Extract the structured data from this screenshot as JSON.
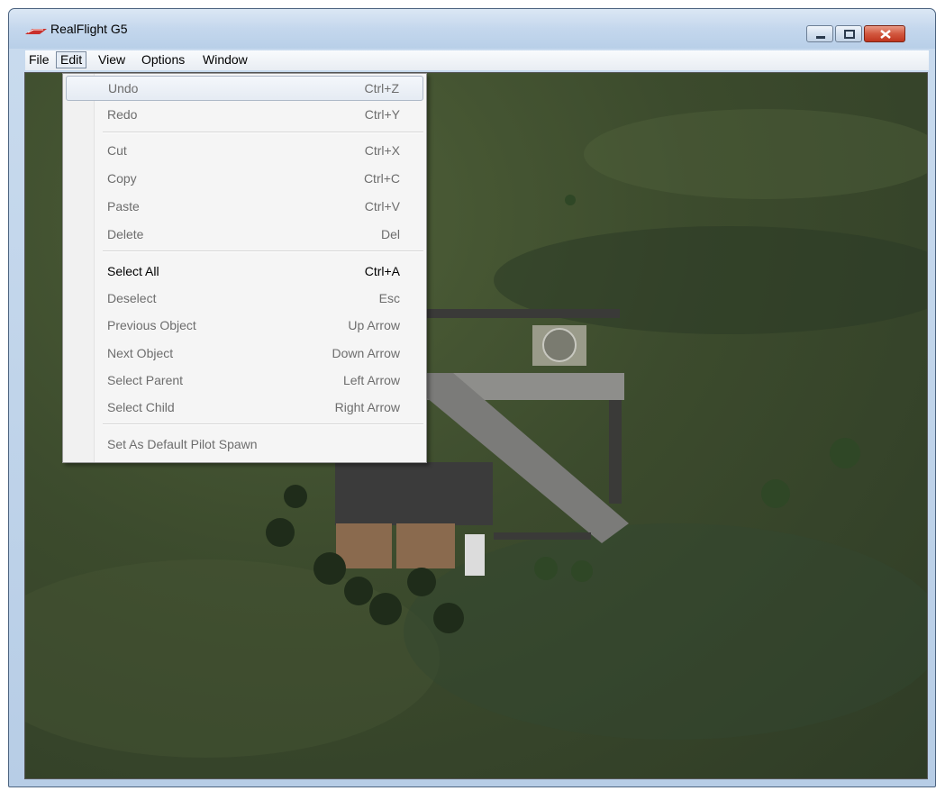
{
  "window": {
    "title": "RealFlight G5"
  },
  "menubar": [
    {
      "label": "File"
    },
    {
      "label": "Edit"
    },
    {
      "label": "View"
    },
    {
      "label": "Options"
    },
    {
      "label": "Window"
    }
  ],
  "edit_menu": [
    {
      "label": "Undo",
      "shortcut": "Ctrl+Z",
      "enabled": false
    },
    {
      "label": "Redo",
      "shortcut": "Ctrl+Y",
      "enabled": false
    },
    {
      "label": "Cut",
      "shortcut": "Ctrl+X",
      "enabled": false
    },
    {
      "label": "Copy",
      "shortcut": "Ctrl+C",
      "enabled": false
    },
    {
      "label": "Paste",
      "shortcut": "Ctrl+V",
      "enabled": false
    },
    {
      "label": "Delete",
      "shortcut": "Del",
      "enabled": false
    },
    {
      "label": "Select All",
      "shortcut": "Ctrl+A",
      "enabled": true
    },
    {
      "label": "Deselect",
      "shortcut": "Esc",
      "enabled": false
    },
    {
      "label": "Previous Object",
      "shortcut": "Up Arrow",
      "enabled": false
    },
    {
      "label": "Next Object",
      "shortcut": "Down Arrow",
      "enabled": false
    },
    {
      "label": "Select Parent",
      "shortcut": "Left Arrow",
      "enabled": false
    },
    {
      "label": "Select Child",
      "shortcut": "Right Arrow",
      "enabled": false
    },
    {
      "label": "Set As Default Pilot Spawn",
      "shortcut": "",
      "enabled": false
    }
  ],
  "colors": {
    "grass": "#3c4b2d",
    "runway": "#8a8a88",
    "menu_bg": "#f5f5f5",
    "close_button": "#c9452c"
  }
}
